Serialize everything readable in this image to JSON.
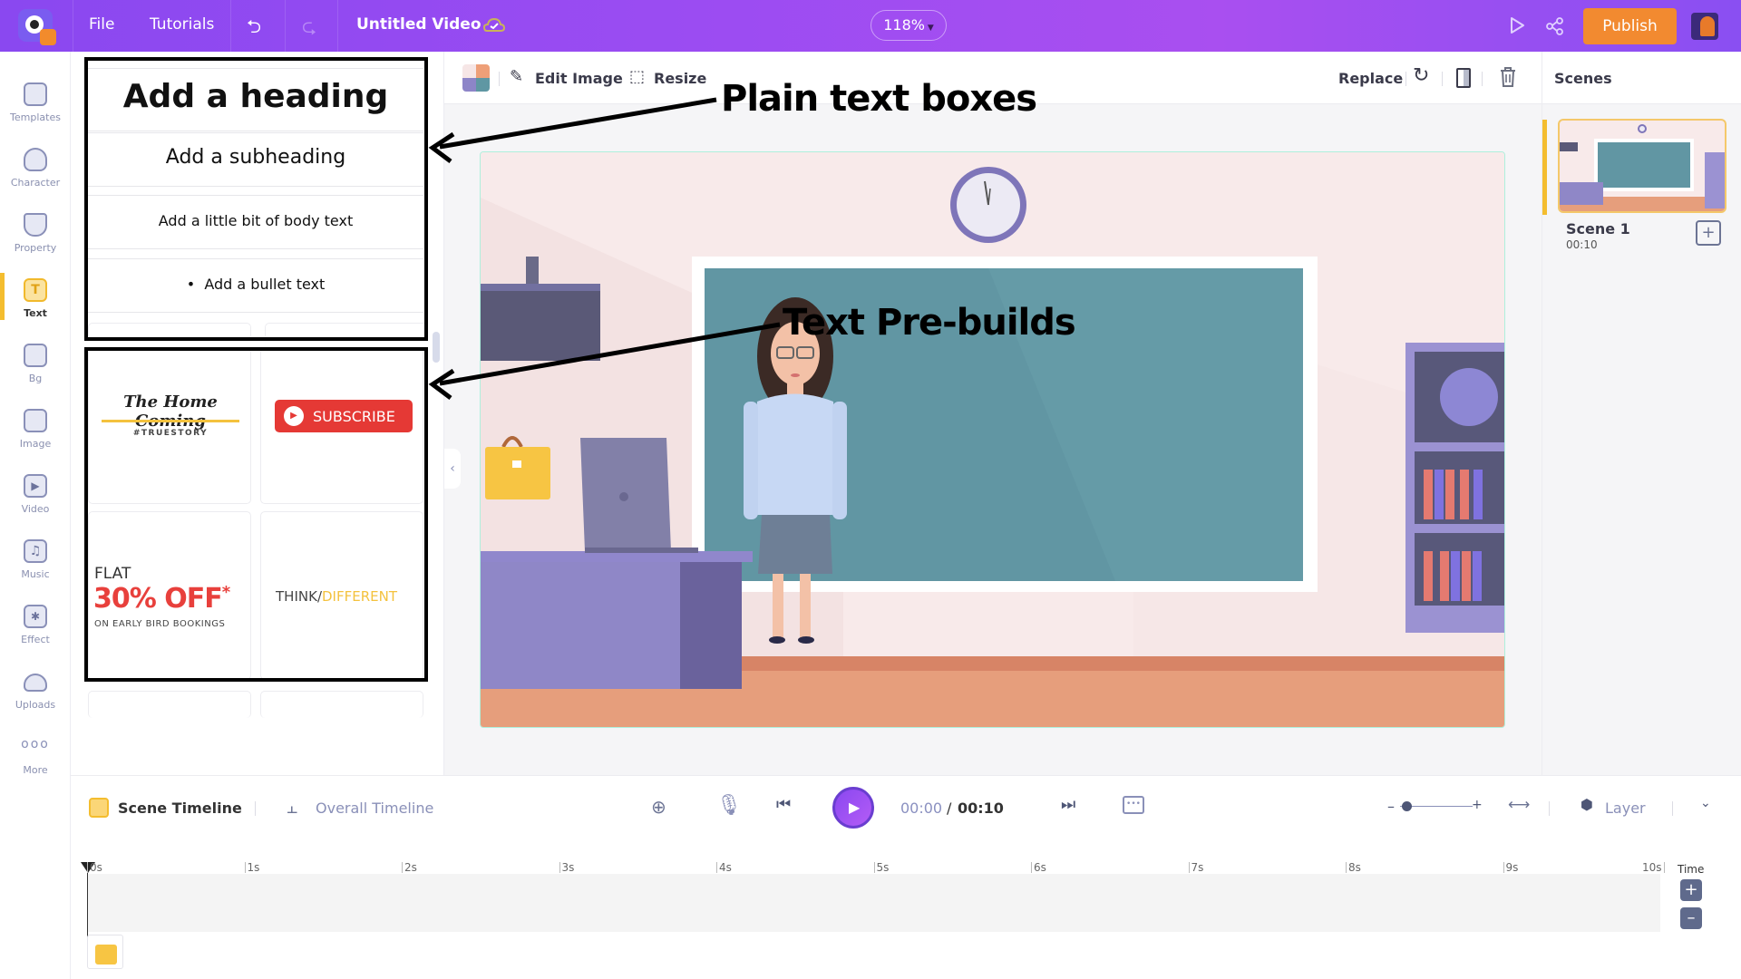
{
  "topbar": {
    "menu": [
      "File",
      "Tutorials"
    ],
    "title": "Untitled Video",
    "zoom": "118%",
    "publish_label": "Publish",
    "icons": [
      "undo-icon",
      "redo-icon",
      "cloud-saved-icon",
      "preview-play-icon",
      "share-icon"
    ]
  },
  "leftnav": {
    "items": [
      {
        "label": "Templates",
        "icon": "clapperboard-icon"
      },
      {
        "label": "Character",
        "icon": "person-icon"
      },
      {
        "label": "Property",
        "icon": "teacup-icon"
      },
      {
        "label": "Text",
        "icon": "text-icon",
        "glyph": "T",
        "active": true
      },
      {
        "label": "Bg",
        "icon": "layers-icon"
      },
      {
        "label": "Image",
        "icon": "image-icon"
      },
      {
        "label": "Video",
        "icon": "video-icon"
      },
      {
        "label": "Music",
        "icon": "music-icon"
      },
      {
        "label": "Effect",
        "icon": "sparkle-icon"
      },
      {
        "label": "Uploads",
        "icon": "cloud-upload-icon"
      },
      {
        "label": "More",
        "icon": "more-dots-icon",
        "glyph": "ooo"
      }
    ]
  },
  "textpanel": {
    "plain": {
      "heading": "Add a heading",
      "subheading": "Add a subheading",
      "body": "Add a little bit of body text",
      "bullet": "Add a bullet text"
    },
    "prebuilds": {
      "homecoming": {
        "title": "The Home Coming",
        "sub": "#TRUESTORY"
      },
      "subscribe": {
        "label": "SUBSCRIBE"
      },
      "sale": {
        "flat": "FLAT",
        "big": "30% OFF",
        "star": "*",
        "sub": "ON EARLY BIRD BOOKINGS"
      },
      "think": {
        "a": "THINK",
        "slash": "/",
        "b": "DIFFERENT"
      }
    }
  },
  "toolbar": {
    "edit_image": "Edit Image",
    "resize": "Resize",
    "replace": "Replace"
  },
  "scenes": {
    "title": "Scenes",
    "items": [
      {
        "name": "Scene 1",
        "duration": "00:10"
      }
    ]
  },
  "timeline": {
    "scene_tab": "Scene Timeline",
    "overall_tab": "Overall Timeline",
    "current": "00:00",
    "divider": "/",
    "total": "00:10",
    "layer": "Layer",
    "time_label": "Time",
    "ticks": [
      "0s",
      "1s",
      "2s",
      "3s",
      "4s",
      "5s",
      "6s",
      "7s",
      "8s",
      "9s",
      "10s"
    ],
    "zoom_level": 0.1
  },
  "annotations": {
    "plain": "Plain text boxes",
    "prebuilds": "Text Pre-builds"
  },
  "colors": {
    "brand_purple": "#9b4cf2",
    "publish_orange": "#f28a30",
    "active_yellow": "#f4bd2f",
    "subscribe_red": "#e53935",
    "sale_red": "#e8403c"
  }
}
